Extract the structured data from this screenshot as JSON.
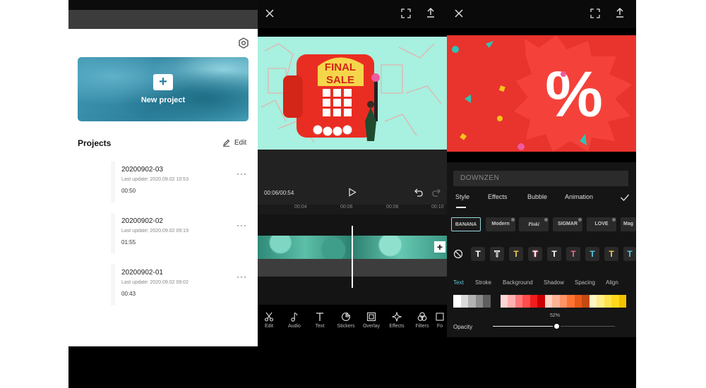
{
  "projects_screen": {
    "new_project_label": "New project",
    "section_title": "Projects",
    "edit_label": "Edit",
    "projects": [
      {
        "name": "20200902-03",
        "last_update": "Last update: 2020.09.02 10:53",
        "duration": "00:50"
      },
      {
        "name": "20200902-02",
        "last_update": "Last update: 2020.09.02 09:19",
        "duration": "01:55"
      },
      {
        "name": "20200902-01",
        "last_update": "Last update: 2020.09.02 09:02",
        "duration": "00:43"
      }
    ],
    "more_label": "···"
  },
  "editor_screen": {
    "preview_text": {
      "line1": "FINAL",
      "line2": "SALE"
    },
    "timecode": "00:06/00:54",
    "ruler_ticks": [
      "00:04",
      "00:06",
      "00:08",
      "00:10"
    ],
    "toolbar": [
      {
        "label": "Edit",
        "icon": "scissors-icon"
      },
      {
        "label": "Audio",
        "icon": "music-note-icon"
      },
      {
        "label": "Text",
        "icon": "text-icon"
      },
      {
        "label": "Stickers",
        "icon": "sticker-icon"
      },
      {
        "label": "Overlay",
        "icon": "overlay-icon"
      },
      {
        "label": "Effects",
        "icon": "effects-icon"
      },
      {
        "label": "Filters",
        "icon": "filters-icon"
      },
      {
        "label": "Fo",
        "icon": "format-icon"
      }
    ]
  },
  "text_screen": {
    "promo_symbol": "%",
    "text_value": "DOWNZEN",
    "tabs": [
      "Style",
      "Effects",
      "Bubble",
      "Animation"
    ],
    "fonts": [
      "BANANA",
      "Modern",
      "Pinki",
      "SIGMAR",
      "LOVE",
      "Mag"
    ],
    "text_styles": [
      {
        "glyph": "T",
        "color": "#ffffff"
      },
      {
        "glyph": "T",
        "color": "#ffffff"
      },
      {
        "glyph": "T",
        "color": "#f2c94c"
      },
      {
        "glyph": "T",
        "color": "#f06a8a"
      },
      {
        "glyph": "T",
        "color": "#ffffff"
      },
      {
        "glyph": "T",
        "color": "#f06a8a"
      },
      {
        "glyph": "T",
        "color": "#56c8e8"
      },
      {
        "glyph": "T",
        "color": "#f2c94c"
      },
      {
        "glyph": "T",
        "color": "#56c8e8"
      }
    ],
    "subtabs": [
      "Text",
      "Stroke",
      "Background",
      "Shadow",
      "Spacing",
      "Align"
    ],
    "swatches": [
      "#ffffff",
      "#d9d9d9",
      "#b3b3b3",
      "#8c8c8c",
      "#5e5e5e",
      "#151515",
      "#ffd6d6",
      "#ffb0b0",
      "#ff7a7a",
      "#ff4d4d",
      "#f21d1d",
      "#cc0000",
      "#ffd3c2",
      "#ffb395",
      "#ff9466",
      "#ff7433",
      "#e85a1a",
      "#c44a12",
      "#fff7c2",
      "#ffef8a",
      "#ffe34d",
      "#ffd91a",
      "#f2c200"
    ],
    "opacity_label": "Opacity",
    "opacity_value": "52%",
    "opacity_level": 0.52
  }
}
